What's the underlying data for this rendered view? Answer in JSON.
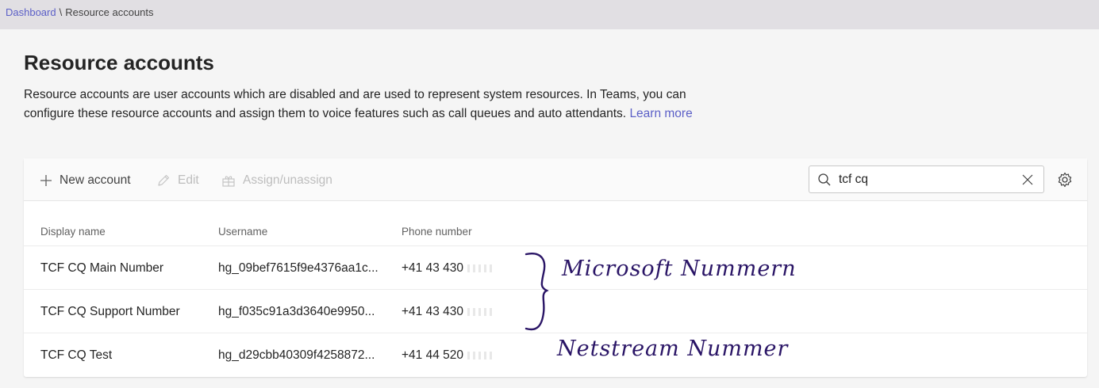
{
  "breadcrumb": {
    "parent": "Dashboard",
    "separator": "\\",
    "current": "Resource accounts"
  },
  "page": {
    "title": "Resource accounts",
    "description": "Resource accounts are user accounts which are disabled and are used to represent system resources. In Teams, you can configure these resource accounts and assign them to voice features such as call queues and auto attendants.",
    "learn_more": "Learn more"
  },
  "toolbar": {
    "new_account": "New account",
    "edit": "Edit",
    "assign": "Assign/unassign"
  },
  "search": {
    "value": "tcf cq"
  },
  "table": {
    "columns": [
      "Display name",
      "Username",
      "Phone number"
    ],
    "rows": [
      {
        "display_name": "TCF CQ Main Number",
        "username": "hg_09bef7615f9e4376aa1c...",
        "phone": "+41 43 430"
      },
      {
        "display_name": "TCF CQ Support Number",
        "username": "hg_f035c91a3d3640e9950...",
        "phone": "+41 43 430"
      },
      {
        "display_name": "TCF CQ Test",
        "username": "hg_d29cbb40309f4258872...",
        "phone": "+41 44 520"
      }
    ]
  },
  "annotations": {
    "microsoft": "Microsoft Nummern",
    "netstream": "Netstream Nummer"
  },
  "colors": {
    "accent": "#5b5fc7",
    "ink": "#2a1566",
    "topbar": "#e1dfe3"
  },
  "icons": [
    "add-icon",
    "edit-icon",
    "assign-icon",
    "search-icon",
    "clear-icon",
    "gear-icon"
  ]
}
